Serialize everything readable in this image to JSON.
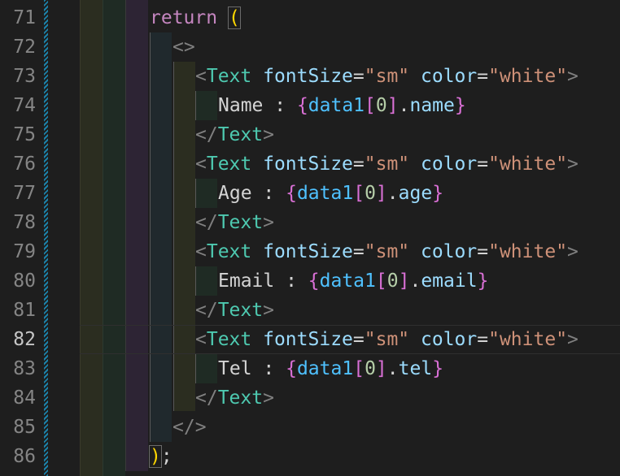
{
  "editor": {
    "line_numbers": [
      "71",
      "72",
      "73",
      "74",
      "75",
      "76",
      "77",
      "78",
      "79",
      "80",
      "81",
      "82",
      "83",
      "84",
      "85",
      "86"
    ],
    "active_line": "82",
    "lines": {
      "l71": {
        "kw": "return",
        "paren": "("
      },
      "l72": {
        "open_fragment": "<>"
      },
      "l73": {
        "lt": "<",
        "tag": "Text",
        "attr1": "fontSize",
        "eq1": "=",
        "val1": "\"sm\"",
        "attr2": "color",
        "eq2": "=",
        "val2": "\"white\"",
        "gt": ">"
      },
      "l74": {
        "label": "Name : ",
        "ob": "{",
        "var": "data1",
        "lb": "[",
        "idx": "0",
        "rb": "]",
        "dot": ".",
        "prop": "name",
        "cb": "}"
      },
      "l75": {
        "close": "</",
        "tag": "Text",
        "gt": ">"
      },
      "l76": {
        "lt": "<",
        "tag": "Text",
        "attr1": "fontSize",
        "eq1": "=",
        "val1": "\"sm\"",
        "attr2": "color",
        "eq2": "=",
        "val2": "\"white\"",
        "gt": ">"
      },
      "l77": {
        "label": "Age : ",
        "ob": "{",
        "var": "data1",
        "lb": "[",
        "idx": "0",
        "rb": "]",
        "dot": ".",
        "prop": "age",
        "cb": "}"
      },
      "l78": {
        "close": "</",
        "tag": "Text",
        "gt": ">"
      },
      "l79": {
        "lt": "<",
        "tag": "Text",
        "attr1": "fontSize",
        "eq1": "=",
        "val1": "\"sm\"",
        "attr2": "color",
        "eq2": "=",
        "val2": "\"white\"",
        "gt": ">"
      },
      "l80": {
        "label": "Email : ",
        "ob": "{",
        "var": "data1",
        "lb": "[",
        "idx": "0",
        "rb": "]",
        "dot": ".",
        "prop": "email",
        "cb": "}"
      },
      "l81": {
        "close": "</",
        "tag": "Text",
        "gt": ">"
      },
      "l82": {
        "lt": "<",
        "tag": "Text",
        "attr1": "fontSize",
        "eq1": "=",
        "val1": "\"sm\"",
        "attr2": "color",
        "eq2": "=",
        "val2": "\"white\"",
        "gt": ">"
      },
      "l83": {
        "label": "Tel : ",
        "ob": "{",
        "var": "data1",
        "lb": "[",
        "idx": "0",
        "rb": "]",
        "dot": ".",
        "prop": "tel",
        "cb": "}"
      },
      "l84": {
        "close": "</",
        "tag": "Text",
        "gt": ">"
      },
      "l85": {
        "close_fragment": "</>"
      },
      "l86": {
        "paren": ")",
        "semi": ";"
      }
    }
  },
  "colors": {
    "background": "#1e1e1e",
    "keyword": "#c586c0",
    "tag": "#4ec9b0",
    "attribute": "#9cdcfe",
    "string": "#ce9178",
    "variable": "#4fc1ff",
    "number": "#b5cea8",
    "bracket_gold": "#ffd700",
    "bracket_pink": "#da70d6"
  }
}
